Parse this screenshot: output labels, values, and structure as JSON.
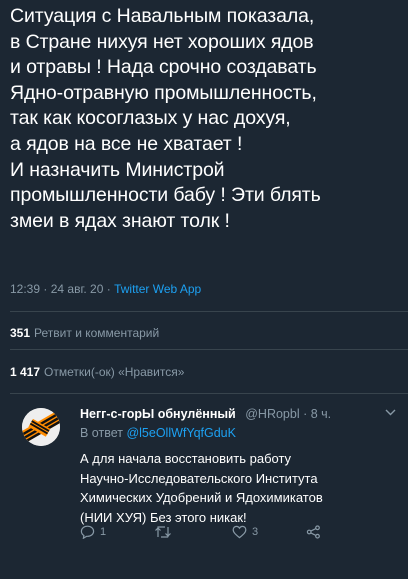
{
  "tweet": {
    "lines": [
      "Ситуация с Навальным показала,",
      "в Стране нихуя нет хороших ядов",
      "и отравы ! Нада срочно создавать",
      "Ядно-отравную промышленность,",
      "так как косоглазых у нас дохуя,",
      "а ядов на все не хватает !",
      "И назначить Министрой",
      "промышленности бабу ! Эти блять",
      "змеи в ядах знают толк !"
    ],
    "time": "12:39",
    "date": "24 авг. 20",
    "separator": "·",
    "app": "Twitter Web App"
  },
  "stats": {
    "retweets_count": "351",
    "retweets_label": "Ретвит и комментарий",
    "likes_count": "1 417",
    "likes_label": "Отметки(-ок) «Нравится»"
  },
  "reply": {
    "name": "Негг-с-горЫ обнулённый",
    "handle": "@HRopbl · 8 ч.",
    "reply_prefix": "В ответ",
    "reply_mention": "@l5eOllWfYqfGduK",
    "body_lines": [
      "А для начала восстановить работу",
      "Научно-Исследовательского Института",
      "Химических Удобрений и Ядохимикатов",
      "(НИИ ХУЯ) Без этого никак!"
    ],
    "reply_count": "1",
    "retweet_count": "",
    "like_count": "3",
    "icons": [
      "reply-icon",
      "retweet-icon",
      "like-icon",
      "share-icon",
      "chevron-down-icon"
    ]
  },
  "colors": {
    "background": "#1c2733",
    "text": "#ffffff",
    "secondary": "#8899a6",
    "accent": "#1da1f2",
    "divider": "#38444d"
  }
}
